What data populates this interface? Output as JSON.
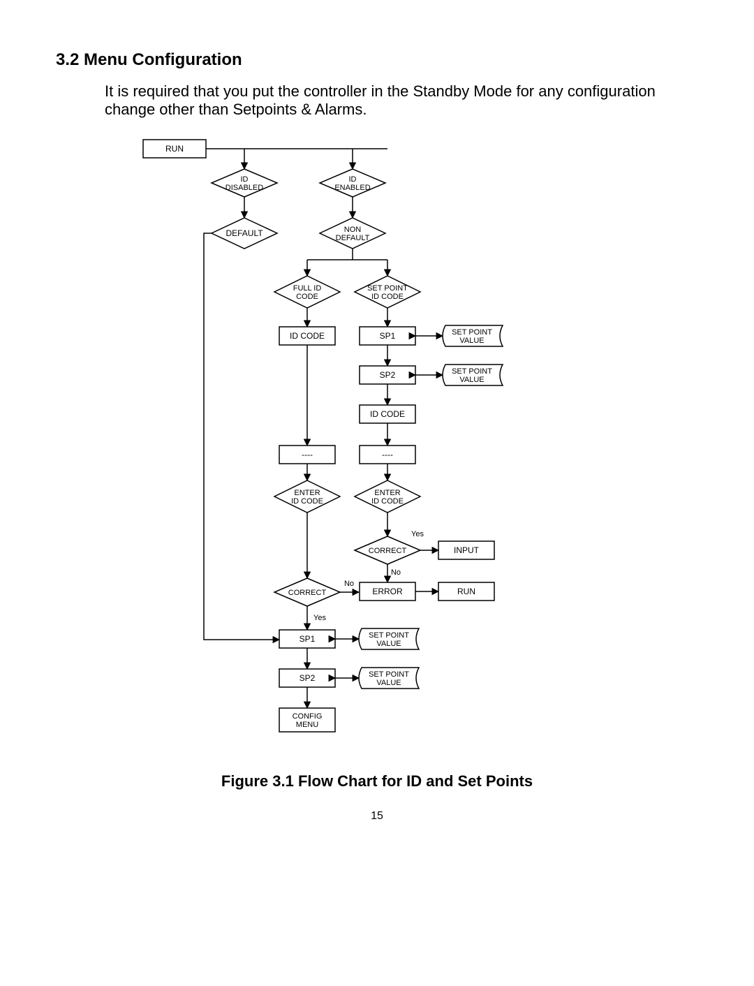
{
  "heading": "3.2 Menu Configuration",
  "paragraph": "It is required that you put the controller in the Standby Mode for any configuration change other than Setpoints & Alarms.",
  "caption": "Figure 3.1 Flow Chart for ID and Set Points",
  "page_number": "15",
  "chart_data": {
    "type": "flowchart",
    "title": "Flow Chart for ID and Set Points",
    "nodes": [
      {
        "id": "run",
        "shape": "rect",
        "label": "RUN"
      },
      {
        "id": "id_disabled",
        "shape": "diamond",
        "label": "ID DISABLED"
      },
      {
        "id": "id_enabled",
        "shape": "diamond",
        "label": "ID ENABLED"
      },
      {
        "id": "default",
        "shape": "diamond",
        "label": "DEFAULT"
      },
      {
        "id": "non_default",
        "shape": "diamond",
        "label": "NON DEFAULT"
      },
      {
        "id": "full_id_code",
        "shape": "diamond",
        "label": "FULL ID CODE"
      },
      {
        "id": "set_point_id_code",
        "shape": "diamond",
        "label": "SET POINT ID CODE"
      },
      {
        "id": "id_code_l",
        "shape": "rect",
        "label": "ID CODE"
      },
      {
        "id": "sp1_top",
        "shape": "rect",
        "label": "SP1"
      },
      {
        "id": "spv1",
        "shape": "storage",
        "label": "SET POINT VALUE"
      },
      {
        "id": "sp2_top",
        "shape": "rect",
        "label": "SP2"
      },
      {
        "id": "spv2",
        "shape": "storage",
        "label": "SET POINT VALUE"
      },
      {
        "id": "id_code_r",
        "shape": "rect",
        "label": "ID CODE"
      },
      {
        "id": "dash_l",
        "shape": "rect",
        "label": "----"
      },
      {
        "id": "dash_r",
        "shape": "rect",
        "label": "----"
      },
      {
        "id": "enter_l",
        "shape": "diamond",
        "label": "ENTER ID CODE"
      },
      {
        "id": "enter_r",
        "shape": "diamond",
        "label": "ENTER ID CODE"
      },
      {
        "id": "correct_r",
        "shape": "diamond",
        "label": "CORRECT"
      },
      {
        "id": "input",
        "shape": "rect",
        "label": "INPUT"
      },
      {
        "id": "correct_l",
        "shape": "diamond",
        "label": "CORRECT"
      },
      {
        "id": "error",
        "shape": "rect",
        "label": "ERROR"
      },
      {
        "id": "run2",
        "shape": "rect",
        "label": "RUN"
      },
      {
        "id": "sp1_b",
        "shape": "rect",
        "label": "SP1"
      },
      {
        "id": "spv3",
        "shape": "storage",
        "label": "SET POINT VALUE"
      },
      {
        "id": "sp2_b",
        "shape": "rect",
        "label": "SP2"
      },
      {
        "id": "spv4",
        "shape": "storage",
        "label": "SET POINT VALUE"
      },
      {
        "id": "config",
        "shape": "rect",
        "label": "CONFIG MENU"
      }
    ],
    "edges": [
      {
        "from": "run",
        "to": "id_disabled"
      },
      {
        "from": "run",
        "to": "id_enabled"
      },
      {
        "from": "id_disabled",
        "to": "default"
      },
      {
        "from": "id_enabled",
        "to": "non_default"
      },
      {
        "from": "default",
        "to": "sp1_b"
      },
      {
        "from": "non_default",
        "to": "full_id_code"
      },
      {
        "from": "non_default",
        "to": "set_point_id_code"
      },
      {
        "from": "full_id_code",
        "to": "id_code_l"
      },
      {
        "from": "set_point_id_code",
        "to": "sp1_top"
      },
      {
        "from": "sp1_top",
        "to": "spv1",
        "dir": "both"
      },
      {
        "from": "sp1_top",
        "to": "sp2_top"
      },
      {
        "from": "sp2_top",
        "to": "spv2",
        "dir": "both"
      },
      {
        "from": "sp2_top",
        "to": "id_code_r"
      },
      {
        "from": "id_code_l",
        "to": "dash_l"
      },
      {
        "from": "id_code_r",
        "to": "dash_r"
      },
      {
        "from": "dash_l",
        "to": "enter_l"
      },
      {
        "from": "dash_r",
        "to": "enter_r"
      },
      {
        "from": "enter_r",
        "to": "correct_r"
      },
      {
        "from": "correct_r",
        "to": "input",
        "label": "Yes"
      },
      {
        "from": "correct_r",
        "to": "error",
        "label": "No"
      },
      {
        "from": "enter_l",
        "to": "correct_l"
      },
      {
        "from": "correct_l",
        "to": "error",
        "label": "No"
      },
      {
        "from": "error",
        "to": "run2"
      },
      {
        "from": "correct_l",
        "to": "sp1_b",
        "label": "Yes"
      },
      {
        "from": "sp1_b",
        "to": "spv3",
        "dir": "both"
      },
      {
        "from": "sp1_b",
        "to": "sp2_b"
      },
      {
        "from": "sp2_b",
        "to": "spv4",
        "dir": "both"
      },
      {
        "from": "sp2_b",
        "to": "config"
      }
    ],
    "edge_labels": {
      "yes": "Yes",
      "no": "No"
    }
  }
}
